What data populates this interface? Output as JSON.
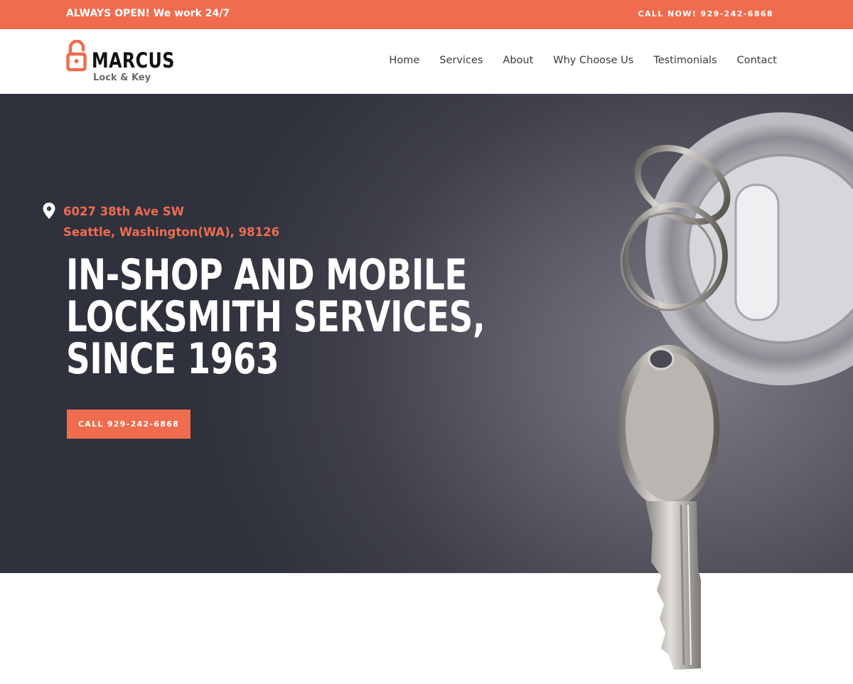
{
  "topbar": {
    "tagline": "ALWAYS OPEN! We work 24/7",
    "call_label": "CALL NOW! 929-242-6868"
  },
  "brand": {
    "name": "MARCUS",
    "subtitle": "Lock & Key",
    "logo_icon": "open-padlock-icon"
  },
  "nav": {
    "items": [
      {
        "label": "Home"
      },
      {
        "label": "Services"
      },
      {
        "label": "About"
      },
      {
        "label": "Why Choose Us"
      },
      {
        "label": "Testimonials"
      },
      {
        "label": "Contact"
      }
    ]
  },
  "hero": {
    "address_icon": "location-pin-icon",
    "address_line1": "6027 38th Ave SW",
    "address_line2": "Seattle, Washington(WA), 98126",
    "headline_line1": "IN-SHOP AND MOBILE",
    "headline_line2": "LOCKSMITH SERVICES,",
    "headline_line3": "SINCE 1963",
    "cta_label": "CALL 929-242-6868"
  },
  "colors": {
    "accent": "#ef6c4f",
    "hero_bg": "#3e3f4b",
    "text_dark": "#111111"
  }
}
